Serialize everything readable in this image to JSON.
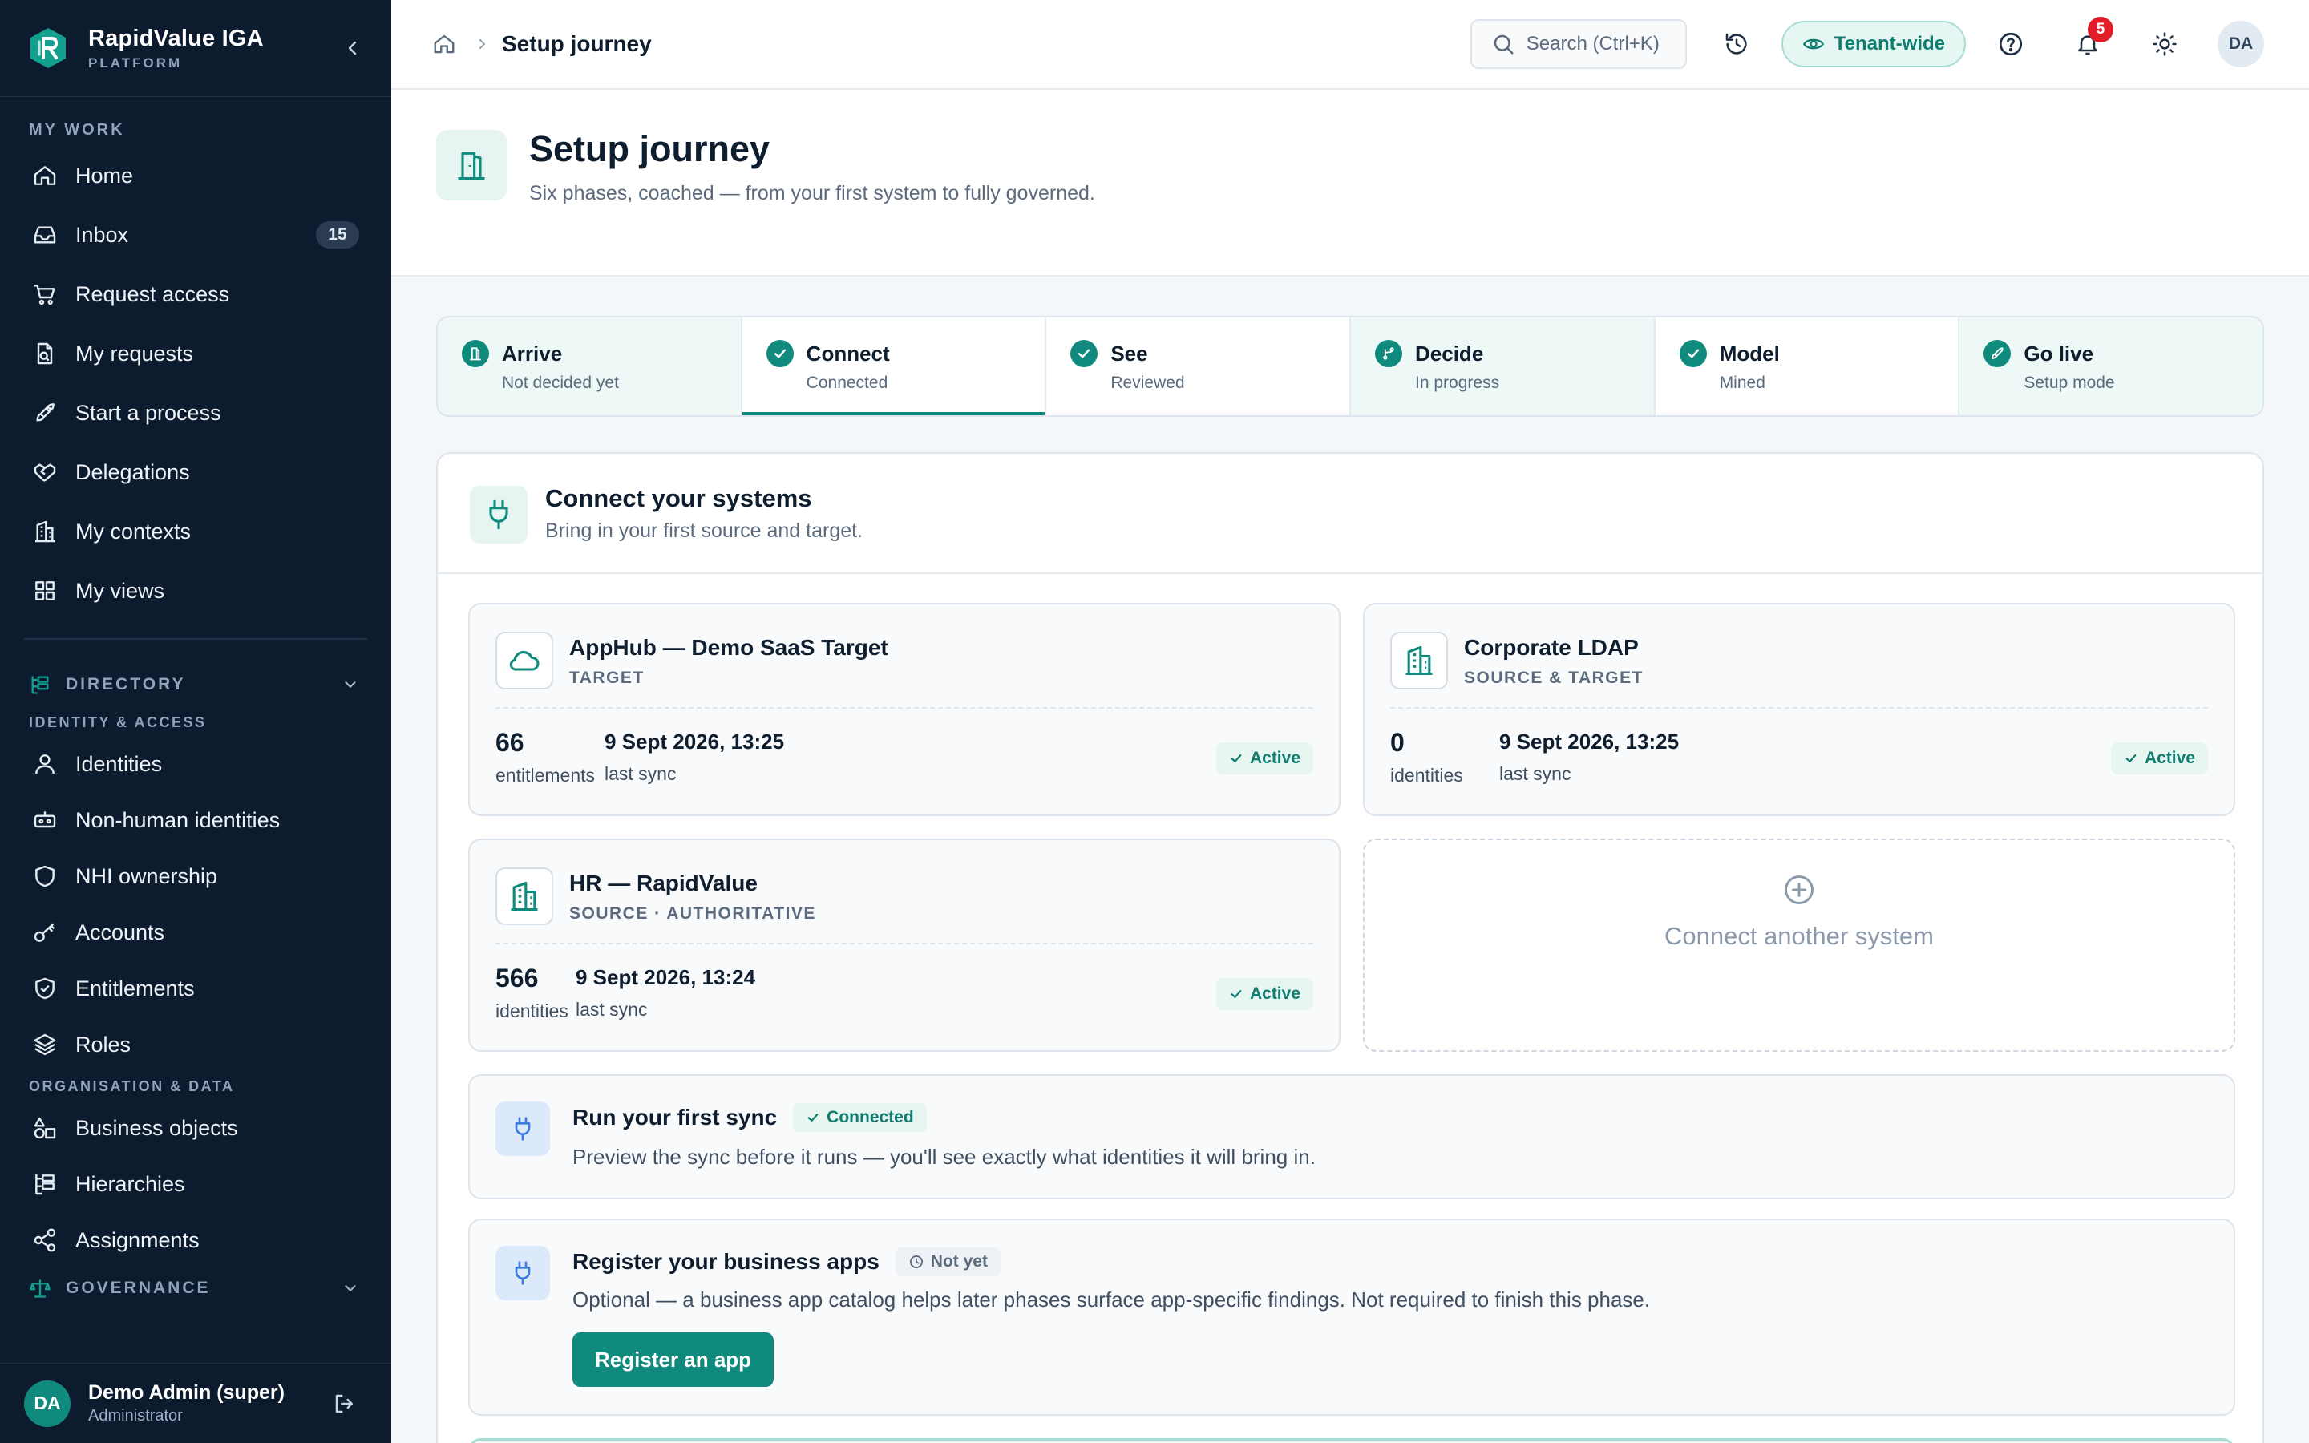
{
  "brand": {
    "name": "RapidValue IGA",
    "sub": "PLATFORM"
  },
  "sidebar": {
    "my_work_label": "MY WORK",
    "my_work": [
      {
        "label": "Home",
        "icon": "home-icon"
      },
      {
        "label": "Inbox",
        "icon": "inbox-icon",
        "badge": "15"
      },
      {
        "label": "Request access",
        "icon": "cart-icon"
      },
      {
        "label": "My requests",
        "icon": "requests-icon"
      },
      {
        "label": "Start a process",
        "icon": "rocket-icon"
      },
      {
        "label": "Delegations",
        "icon": "handshake-icon"
      },
      {
        "label": "My contexts",
        "icon": "building-icon"
      },
      {
        "label": "My views",
        "icon": "grid-icon"
      }
    ],
    "directory_label": "DIRECTORY",
    "identity_access_label": "IDENTITY & ACCESS",
    "identity_access": [
      {
        "label": "Identities",
        "icon": "user-icon"
      },
      {
        "label": "Non-human identities",
        "icon": "bot-icon"
      },
      {
        "label": "NHI ownership",
        "icon": "shield-icon"
      },
      {
        "label": "Accounts",
        "icon": "key-icon"
      },
      {
        "label": "Entitlements",
        "icon": "shield-check-icon"
      },
      {
        "label": "Roles",
        "icon": "layers-icon"
      }
    ],
    "org_data_label": "ORGANISATION & DATA",
    "org_data": [
      {
        "label": "Business objects",
        "icon": "shapes-icon"
      },
      {
        "label": "Hierarchies",
        "icon": "hierarchy-icon"
      },
      {
        "label": "Assignments",
        "icon": "share-icon"
      }
    ],
    "governance_label": "GOVERNANCE",
    "user": {
      "initials": "DA",
      "name": "Demo Admin (super)",
      "role": "Administrator"
    }
  },
  "topbar": {
    "breadcrumb_current": "Setup journey",
    "search_placeholder": "Search (Ctrl+K)",
    "tenant_label": "Tenant-wide",
    "notif_count": "5",
    "avatar_initials": "DA"
  },
  "header": {
    "title": "Setup journey",
    "subtitle": "Six phases, coached — from your first system to fully governed."
  },
  "steps": [
    {
      "name": "Arrive",
      "status": "Not decided yet",
      "icon": "door-icon"
    },
    {
      "name": "Connect",
      "status": "Connected",
      "icon": "check-icon"
    },
    {
      "name": "See",
      "status": "Reviewed",
      "icon": "check-icon"
    },
    {
      "name": "Decide",
      "status": "In progress",
      "icon": "branch-icon"
    },
    {
      "name": "Model",
      "status": "Mined",
      "icon": "check-icon"
    },
    {
      "name": "Go live",
      "status": "Setup mode",
      "icon": "rocket-icon"
    }
  ],
  "connect": {
    "title": "Connect your systems",
    "subtitle": "Bring in your first source and target.",
    "systems": [
      {
        "name": "AppHub — Demo SaaS Target",
        "type": "TARGET",
        "count": "66",
        "unit": "entitlements",
        "date": "9 Sept 2026, 13:25",
        "last": "last sync",
        "status": "Active",
        "icon": "cloud-icon"
      },
      {
        "name": "Corporate LDAP",
        "type": "SOURCE & TARGET",
        "count": "0",
        "unit": "identities",
        "date": "9 Sept 2026, 13:25",
        "last": "last sync",
        "status": "Active",
        "icon": "building-icon"
      },
      {
        "name": "HR — RapidValue",
        "type": "SOURCE · AUTHORITATIVE",
        "count": "566",
        "unit": "identities",
        "date": "9 Sept 2026, 13:24",
        "last": "last sync",
        "status": "Active",
        "icon": "building-icon"
      }
    ],
    "add_label": "Connect another system",
    "sync_task": {
      "title": "Run your first sync",
      "badge": "Connected",
      "desc": "Preview the sync before it runs — you'll see exactly what identities it will bring in."
    },
    "apps_task": {
      "title": "Register your business apps",
      "badge": "Not yet",
      "desc": "Optional — a business app catalog helps later phases surface app-specific findings. Not required to finish this phase.",
      "button": "Register an app"
    }
  },
  "colors": {
    "accent": "#0f8a7c",
    "sidebar": "#0d1b2e",
    "badge": "#e11d2a"
  }
}
